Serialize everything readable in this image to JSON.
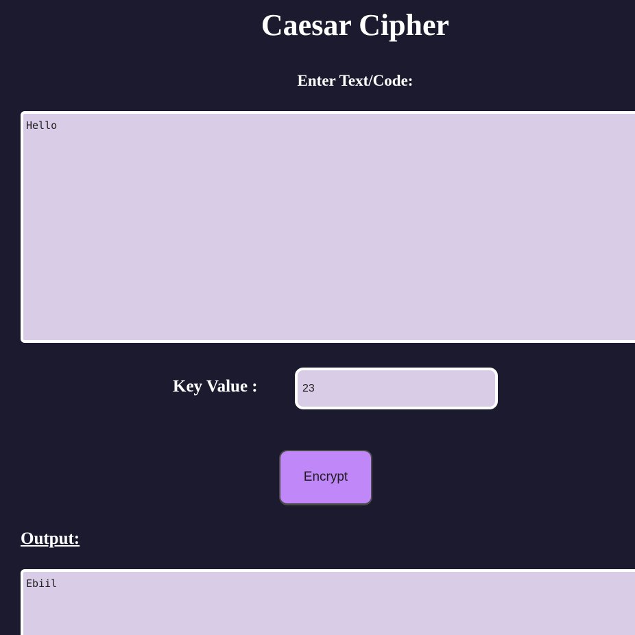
{
  "page": {
    "title": "Caesar Cipher",
    "input_label": "Enter Text/Code:"
  },
  "input": {
    "value": "Hello"
  },
  "key": {
    "label": "Key Value :",
    "value": "23"
  },
  "actions": {
    "encrypt_label": "Encrypt"
  },
  "output": {
    "heading": "Output:",
    "value": "Ebiil"
  },
  "colors": {
    "background": "#1b1a2e",
    "field": "#d9cce6",
    "button": "#bf87f7",
    "text": "#ffffff"
  }
}
